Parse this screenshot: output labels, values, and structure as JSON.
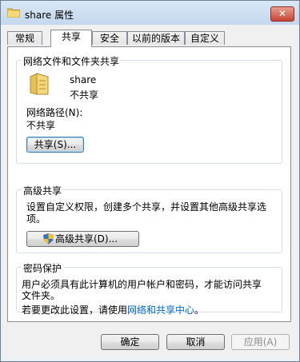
{
  "window": {
    "title": "share 属性",
    "close_label": "✕"
  },
  "tabs": [
    {
      "label": "常规"
    },
    {
      "label": "共享"
    },
    {
      "label": "安全"
    },
    {
      "label": "以前的版本"
    },
    {
      "label": "自定义"
    }
  ],
  "network_share": {
    "group_title": "网络文件和文件夹共享",
    "folder_name": "share",
    "status": "不共享",
    "path_label": "网络路径(N):",
    "path_value": "不共享",
    "share_button": "共享(S)..."
  },
  "advanced_share": {
    "group_title": "高级共享",
    "description_line1": "设置自定义权限，创建多个共享，并设置其他高级共享选",
    "description_line2": "项。",
    "button": "高级共享(D)..."
  },
  "password": {
    "group_title": "密码保护",
    "line1": "用户必须具有此计算机的用户帐户和密码，才能访问共享",
    "line2": "文件夹。",
    "line3_prefix": "若要更改此设置，请使用",
    "line3_link": "网络和共享中心",
    "line3_suffix": "。"
  },
  "footer": {
    "ok": "确定",
    "cancel": "取消",
    "apply": "应用(A)"
  }
}
